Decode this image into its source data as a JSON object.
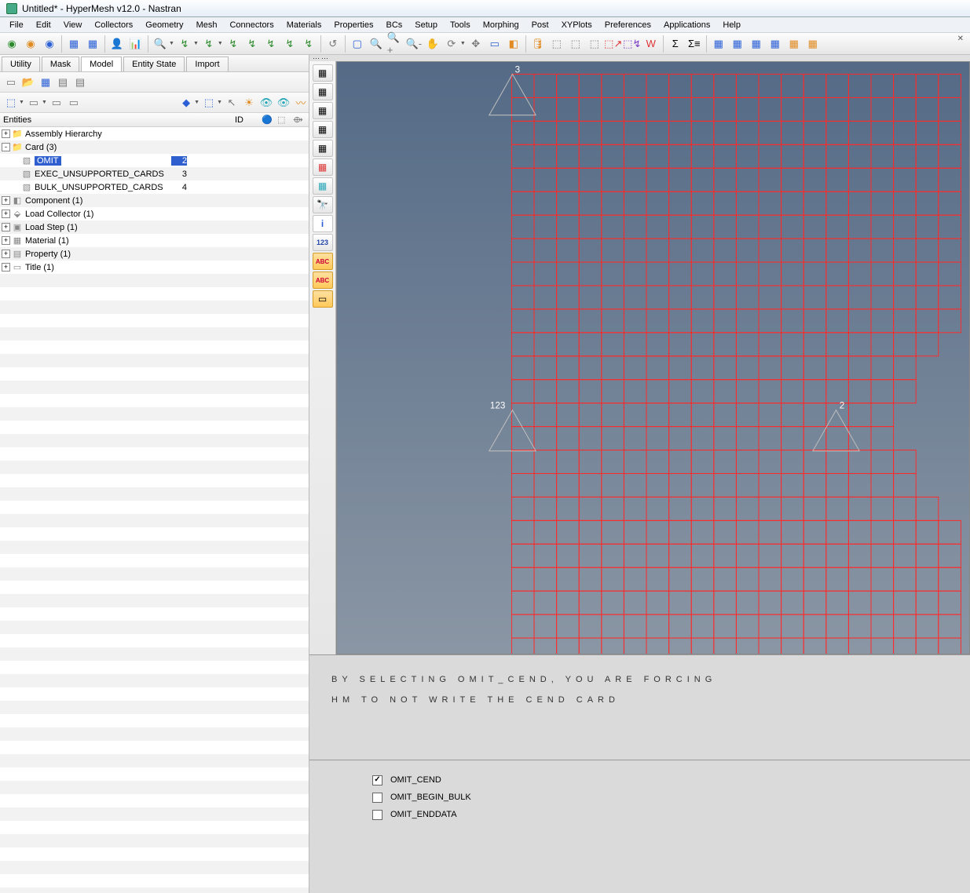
{
  "window_title": "Untitled* - HyperMesh v12.0 - Nastran",
  "menu": [
    "File",
    "Edit",
    "View",
    "Collectors",
    "Geometry",
    "Mesh",
    "Connectors",
    "Materials",
    "Properties",
    "BCs",
    "Setup",
    "Tools",
    "Morphing",
    "Post",
    "XYPlots",
    "Preferences",
    "Applications",
    "Help"
  ],
  "left": {
    "tabs": [
      "Utility",
      "Mask",
      "Model",
      "Entity State",
      "Import"
    ],
    "active_tab": 2,
    "header": {
      "c1": "Entities",
      "c2": "ID"
    },
    "tree": [
      {
        "depth": 0,
        "expand": "+",
        "icon": "folder",
        "label": "Assembly Hierarchy",
        "id": ""
      },
      {
        "depth": 0,
        "expand": "-",
        "icon": "folder",
        "label": "Card (3)",
        "id": ""
      },
      {
        "depth": 1,
        "expand": "",
        "icon": "card",
        "label": "OMIT",
        "id": "2",
        "selected": true
      },
      {
        "depth": 1,
        "expand": "",
        "icon": "card",
        "label": "EXEC_UNSUPPORTED_CARDS",
        "id": "3"
      },
      {
        "depth": 1,
        "expand": "",
        "icon": "card",
        "label": "BULK_UNSUPPORTED_CARDS",
        "id": "4"
      },
      {
        "depth": 0,
        "expand": "+",
        "icon": "comp",
        "label": "Component (1)",
        "id": ""
      },
      {
        "depth": 0,
        "expand": "+",
        "icon": "load",
        "label": "Load Collector (1)",
        "id": ""
      },
      {
        "depth": 0,
        "expand": "+",
        "icon": "step",
        "label": "Load Step (1)",
        "id": ""
      },
      {
        "depth": 0,
        "expand": "+",
        "icon": "mat",
        "label": "Material (1)",
        "id": ""
      },
      {
        "depth": 0,
        "expand": "+",
        "icon": "prop",
        "label": "Property (1)",
        "id": ""
      },
      {
        "depth": 0,
        "expand": "+",
        "icon": "title",
        "label": "Title (1)",
        "id": ""
      }
    ]
  },
  "viewport": {
    "labels": {
      "top": "3",
      "left": "123",
      "right": "2"
    }
  },
  "message": {
    "line1": "BY SELECTING OMIT_CEND, YOU ARE FORCING",
    "line2": "HM TO NOT WRITE THE  CEND  CARD"
  },
  "card_options": [
    {
      "label": "OMIT_CEND",
      "checked": true
    },
    {
      "label": "OMIT_BEGIN_BULK",
      "checked": false
    },
    {
      "label": "OMIT_ENDDATA",
      "checked": false
    }
  ]
}
